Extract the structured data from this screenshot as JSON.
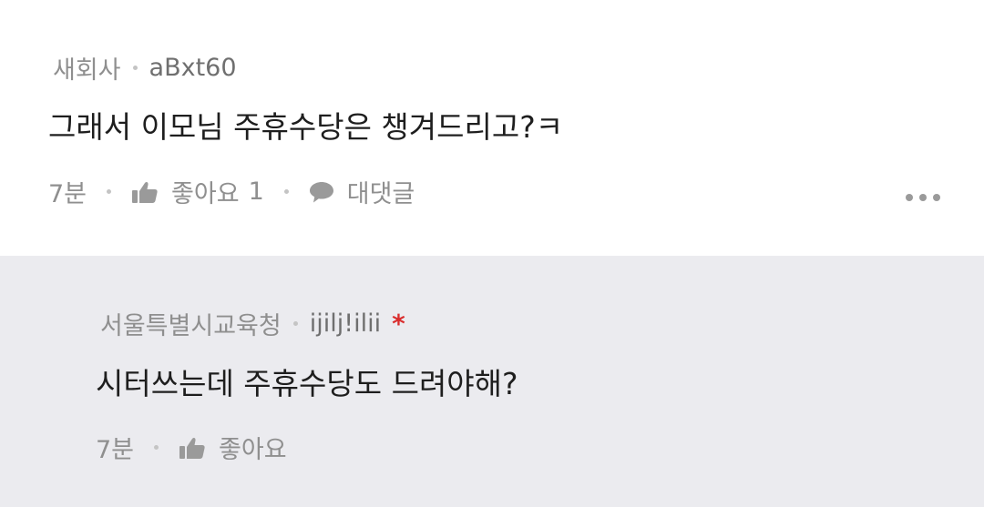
{
  "comments": [
    {
      "company": "새회사",
      "nickname": "aBxt60",
      "body": "그래서 이모님 주휴수당은 챙겨드리고?ㅋ",
      "time": "7분",
      "like_label": "좋아요",
      "like_count": "1",
      "reply_label": "대댓글"
    }
  ],
  "reply": {
    "company": "서울특별시교육청",
    "nickname": "ijilj!ilii",
    "author_marker": "*",
    "body": "시터쓰는데 주휴수당도 드려야해?",
    "time": "7분",
    "like_label": "좋아요"
  },
  "icons": {
    "like": "thumbs-up-icon",
    "reply": "speech-bubble-icon",
    "more": "more-dots-icon"
  },
  "colors": {
    "reply_background": "#ebebef",
    "author_marker": "#d92d2d"
  }
}
